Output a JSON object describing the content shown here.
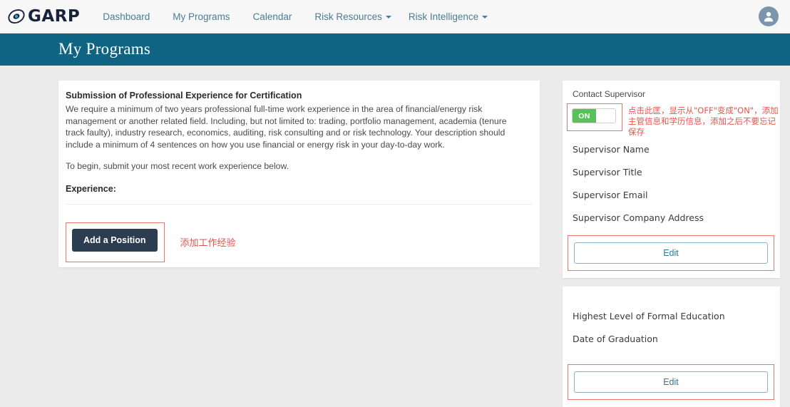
{
  "nav": {
    "logo_text": "GARP",
    "logo_icon": "garp-eye-icon",
    "links": [
      {
        "label": "Dashboard",
        "caret": false
      },
      {
        "label": "My Programs",
        "caret": false
      },
      {
        "label": "Calendar",
        "caret": false
      },
      {
        "label": "Risk Resources",
        "caret": true
      },
      {
        "label": "Risk Intelligence",
        "caret": true
      }
    ],
    "avatar_icon": "user-avatar-icon"
  },
  "banner": {
    "title": "My Programs"
  },
  "main": {
    "heading": "Submission of Professional Experience for Certification",
    "paragraph": "We require a minimum of two years professional full-time work experience in the area of financial/energy risk management or another related field. Including, but not limited to: trading, portfolio management, academia (tenure track faulty), industry research, economics, auditing, risk consulting and or risk technology. Your description should include a minimum of 4 sentences on how you use financial or energy risk in your day-to-day work.",
    "paragraph2": "To begin, submit your most recent work experience below.",
    "experience_label": "Experience:",
    "add_position_label": "Add a Position",
    "annotation_cn": "添加工作经验"
  },
  "sidebar": {
    "contact_supervisor_label": "Contact Supervisor",
    "toggle_state": "ON",
    "annotation_cn": "点击此匡，显示从\"OFF\"变成\"ON\"，添加主管信息和学历信息，添加之后不要忘记保存",
    "supervisor_fields": [
      "Supervisor Name",
      "Supervisor Title",
      "Supervisor Email",
      "Supervisor Company Address"
    ],
    "edit_label_supervisor": "Edit",
    "education_fields": [
      "Highest Level of Formal Education",
      "Date of Graduation"
    ],
    "edit_label_education": "Edit"
  },
  "colors": {
    "banner_blue": "#0f6484",
    "nav_link": "#4a7c94",
    "button_dark": "#2b3d51",
    "annotation_red": "#e8524a",
    "annotation_border": "#e8766e",
    "toggle_green": "#58c15a",
    "edit_blue": "#2e7a9e",
    "page_bg": "#ebebeb"
  }
}
